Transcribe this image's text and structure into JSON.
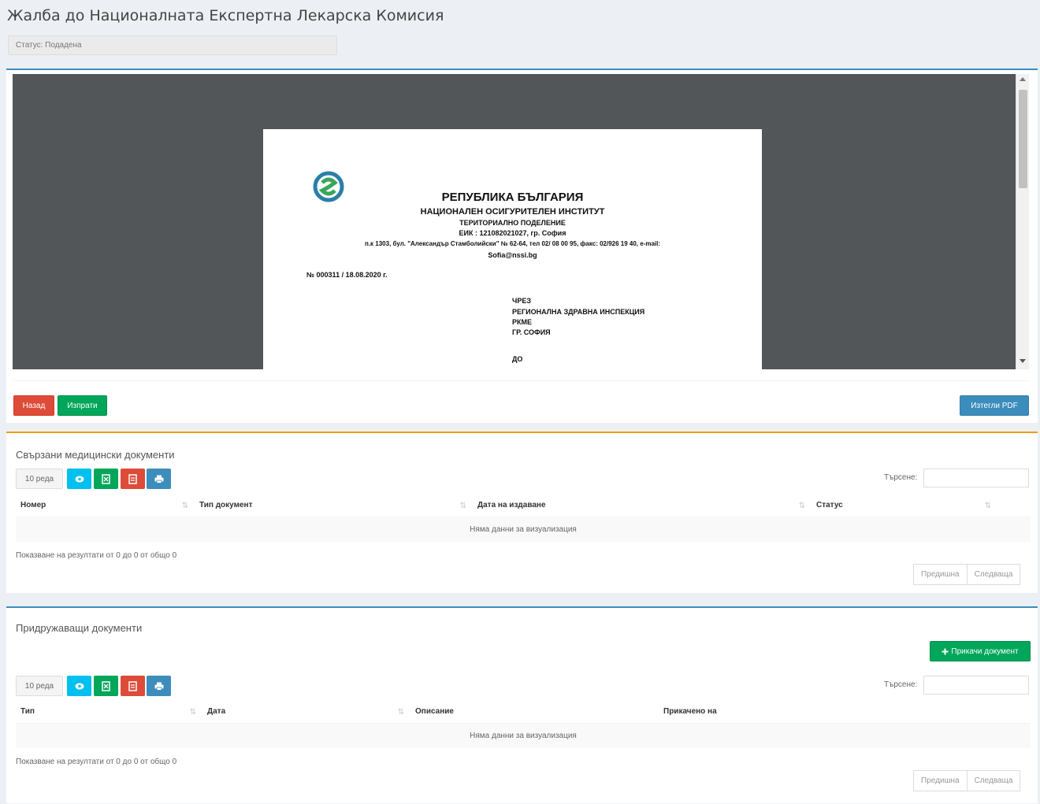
{
  "page": {
    "title": "Жалба до Националната Експертна Лекарска Комисия",
    "status": "Статус: Подадена"
  },
  "viewer": {
    "document": {
      "heading": "РЕПУБЛИКА БЪЛГАРИЯ",
      "subheading": "НАЦИОНАЛЕН ОСИГУРИТЕЛЕН ИНСТИТУТ",
      "division": "ТЕРИТОРИАЛНО ПОДЕЛЕНИЕ",
      "eik": "ЕИК : 121082021027, гр. София",
      "address": "п.к 1303, бул. \"Александър Стамболийски\" № 62-64, тел 02/ 08 00 95, факс: 02/926 19 40, e-mail:",
      "email": "Sofia@nssi.bg",
      "number": "№ 000311 / 18.08.2020 г.",
      "via": "ЧРЕЗ",
      "recipient1": "РЕГИОНАЛНА ЗДРАВНА ИНСПЕКЦИЯ",
      "recipient2": "РКМЕ",
      "recipient3": "ГР. СОФИЯ",
      "to": "ДО"
    }
  },
  "actions": {
    "back": "Назад",
    "send": "Изпрати",
    "download_pdf": "Изтегли PDF"
  },
  "medical_docs": {
    "title": "Свързани медицински документи",
    "rows_select": "10 реда",
    "search_label": "Търсене:",
    "columns": [
      "Номер",
      "Тип документ",
      "Дата на издаване",
      "Статус"
    ],
    "empty": "Няма данни за визуализация",
    "info": "Показване на резултати от 0 до 0 от общо 0",
    "prev": "Предишна",
    "next": "Следваща"
  },
  "attached_docs": {
    "title": "Придружаващи документи",
    "attach_button": "Прикачи документ",
    "rows_select": "10 реда",
    "search_label": "Търсене:",
    "columns": [
      "Тип",
      "Дата",
      "Описание",
      "Прикачено на"
    ],
    "empty": "Няма данни за визуализация",
    "info": "Показване на резултати от 0 до 0 от общо 0",
    "prev": "Предишна",
    "next": "Следваща"
  },
  "colors": {
    "red": "#dd4b39",
    "green": "#00a65a",
    "blue": "#3c8dbc",
    "aqua": "#00c0ef",
    "orange": "#f39c12"
  },
  "icons": [
    "eye-icon",
    "excel-icon",
    "pdf-icon",
    "print-icon",
    "plus-icon"
  ]
}
